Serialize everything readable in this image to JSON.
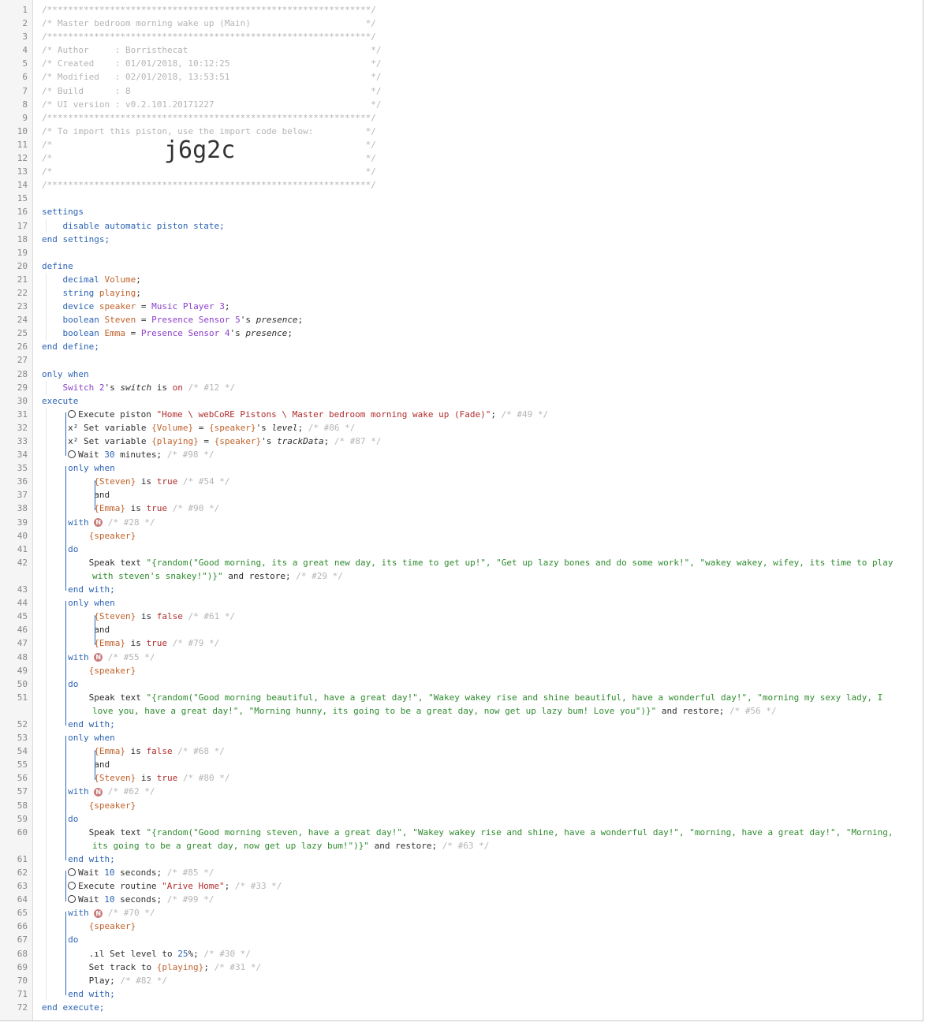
{
  "header": {
    "l1": "/**************************************************************/",
    "l2": "/* Master bedroom morning wake up (Main)                      */",
    "l3": "/**************************************************************/",
    "l4": "/* Author     : Borristhecat                                   */",
    "l5": "/* Created    : 01/01/2018, 10:12:25                           */",
    "l6": "/* Modified   : 02/01/2018, 13:53:51                           */",
    "l7": "/* Build      : 8                                              */",
    "l8": "/* UI version : v0.2.101.20171227                              */",
    "l9": "/**************************************************************/",
    "l10": "/* To import this piston, use the import code below:          */",
    "l11": "/*                                                            */",
    "l12": "/*                                                            */",
    "l13": "/*                                                            */",
    "l14": "/**************************************************************/",
    "import_code": "j6g2c"
  },
  "line_numbers": [
    "1",
    "2",
    "3",
    "4",
    "5",
    "6",
    "7",
    "8",
    "9",
    "10",
    "11",
    "12",
    "13",
    "14",
    "15",
    "16",
    "17",
    "18",
    "19",
    "20",
    "21",
    "22",
    "23",
    "24",
    "25",
    "26",
    "27",
    "28",
    "29",
    "30",
    "31",
    "32",
    "33",
    "34",
    "35",
    "36",
    "37",
    "38",
    "39",
    "40",
    "41",
    "42",
    "43",
    "44",
    "45",
    "46",
    "47",
    "48",
    "49",
    "50",
    "51",
    "52",
    "53",
    "54",
    "55",
    "56",
    "57",
    "58",
    "59",
    "60",
    "61",
    "62",
    "63",
    "64",
    "65",
    "66",
    "67",
    "68",
    "69",
    "70",
    "71",
    "72"
  ],
  "code": {
    "settings": "settings",
    "disable_state": "disable automatic piston state;",
    "end_settings": "end settings;",
    "define": "define",
    "decimal": "decimal",
    "volume": "Volume",
    "string": "string",
    "playing": "playing",
    "device": "device",
    "speaker": "speaker",
    "music_player": "Music Player 3",
    "boolean": "boolean",
    "steven": "Steven",
    "presence5": "Presence Sensor 5",
    "presence_attr": "presence",
    "emma": "Emma",
    "presence4": "Presence Sensor 4",
    "end_define": "end define;",
    "only_when": "only when",
    "switch2": "Switch 2",
    "switch_attr": "switch",
    "on": "on",
    "c12": "/* #12 */",
    "execute": "execute",
    "exec_piston": "Execute piston ",
    "piston_path": "\"Home \\ webCoRE Pistons \\ Master bedroom morning wake up (Fade)\"",
    "c49": "/* #49 */",
    "set_variable": "Set variable ",
    "v_volume": "{Volume}",
    "v_speaker": "{speaker}",
    "level_attr": "level",
    "c86": "/* #86 */",
    "v_playing": "{playing}",
    "trackdata_attr": "trackData",
    "c87": "/* #87 */",
    "wait": "Wait ",
    "thirty": "30",
    "minutes": " minutes;",
    "c98": "/* #98 */",
    "v_steven": "{Steven}",
    "v_emma": "{Emma}",
    "is_true": "true",
    "is_false": "false",
    "c54": "/* #54 */",
    "c90": "/* #90 */",
    "and": "and",
    "with": "with",
    "c28": "/* #28 */",
    "do": "do",
    "speak_text": "Speak text ",
    "speak1a": "\"{random(\"Good morning, its a great new day, its time to get up!\", \"Get up lazy bones and do some work!\", \"wakey wakey, wifey, its time to play",
    "speak1b": "with steven's snakey!\")}\"",
    "and_restore": " and restore;",
    "c29": "/* #29 */",
    "end_with": "end with;",
    "c61": "/* #61 */",
    "c79": "/* #79 */",
    "c55": "/* #55 */",
    "speak2a": "\"{random(\"Good morning beautiful, have a great day!\", \"Wakey wakey rise and shine beautiful, have a wonderful day!\", \"morning my sexy lady, I",
    "speak2b": "love you, have a great day!\", \"Morning hunny, its going to be a great day, now get up lazy bum! Love you\")}\"",
    "c56": "/* #56 */",
    "c68": "/* #68 */",
    "c80": "/* #80 */",
    "c62": "/* #62 */",
    "speak3a": "\"{random(\"Good morning steven, have a great day!\", \"Wakey wakey rise and shine, have a wonderful day!\", \"morning, have a great day!\", \"Morning,",
    "speak3b": "its going to be a great day, now get up lazy bum!\")}\"",
    "c63": "/* #63 */",
    "ten": "10",
    "seconds": " seconds;",
    "c85": "/* #85 */",
    "exec_routine": "Execute routine ",
    "routine_name": "\"Arive Home\"",
    "c33": "/* #33 */",
    "c99": "/* #99 */",
    "c70": "/* #70 */",
    "set_level": "Set level to ",
    "pct": "25",
    "c30": "/* #30 */",
    "set_track": "Set track to ",
    "c31": "/* #31 */",
    "play": "Play;",
    "c82": "/* #82 */",
    "end_execute": "end execute;",
    "n": "N",
    "x2": "x²"
  }
}
